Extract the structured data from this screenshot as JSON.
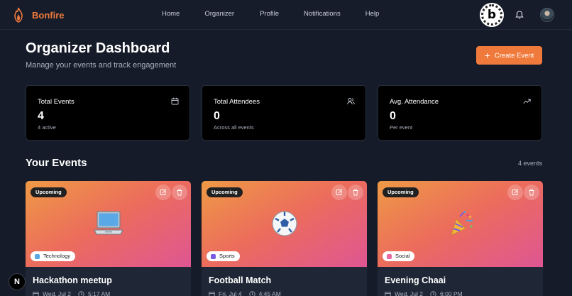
{
  "brand": {
    "name": "Bonfire"
  },
  "nav": {
    "links": [
      "Home",
      "Organizer",
      "Profile",
      "Notifications",
      "Help"
    ],
    "badge_letter": "b"
  },
  "header": {
    "title": "Organizer Dashboard",
    "subtitle": "Manage your events and track engagement",
    "create_label": "Create Event"
  },
  "stats": [
    {
      "title": "Total Events",
      "value": "4",
      "sub": "4 active",
      "icon": "calendar-icon"
    },
    {
      "title": "Total Attendees",
      "value": "0",
      "sub": "Across all events",
      "icon": "users-icon"
    },
    {
      "title": "Avg. Attendance",
      "value": "0",
      "sub": "Per event",
      "icon": "trending-up-icon"
    }
  ],
  "events_section": {
    "title": "Your Events",
    "count": "4 events"
  },
  "events": [
    {
      "status": "Upcoming",
      "category": "Technology",
      "title": "Hackathon meetup",
      "date": "Wed, Jul 2",
      "time": "5:17 AM",
      "emoji": "laptop"
    },
    {
      "status": "Upcoming",
      "category": "Sports",
      "title": "Football Match",
      "date": "Fri, Jul 4",
      "time": "4:45 AM",
      "emoji": "soccer-ball"
    },
    {
      "status": "Upcoming",
      "category": "Social",
      "title": "Evening Chaai",
      "date": "Wed, Jul 2",
      "time": "6:00 PM",
      "emoji": "party-popper"
    }
  ],
  "dev_badge": {
    "letter": "N"
  },
  "colors": {
    "accent": "#f07a3c",
    "background": "#151b29",
    "card": "#000000"
  }
}
